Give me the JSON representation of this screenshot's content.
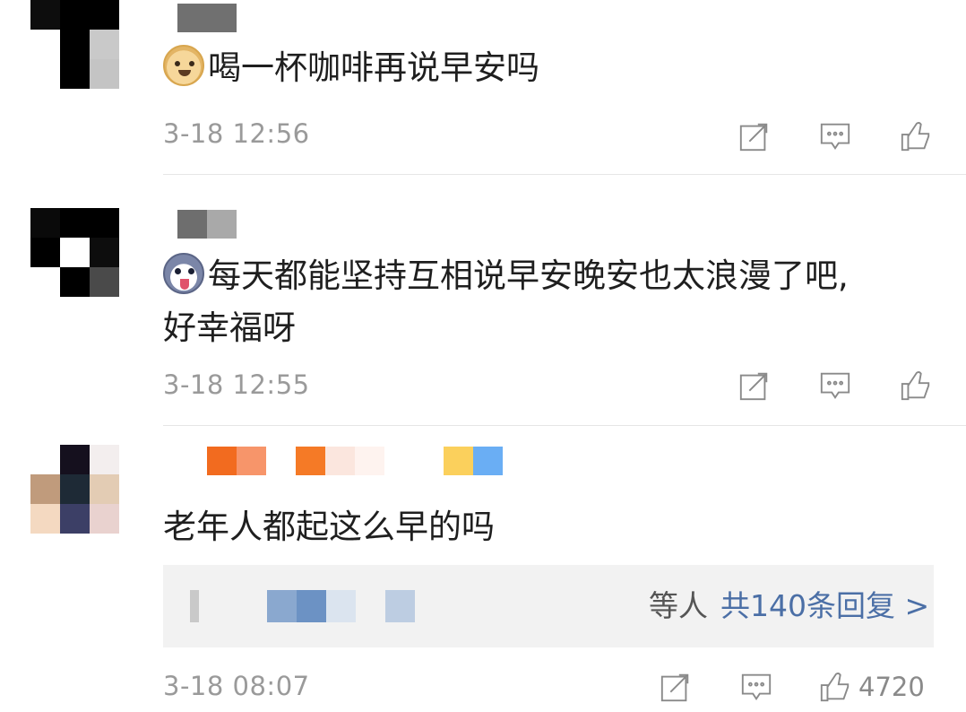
{
  "comments": [
    {
      "avatar_icon": "blurred-avatar",
      "emoji_icon": "doge-emoji",
      "text": "喝一杯咖啡再说早安吗",
      "time": "3-18 12:56"
    },
    {
      "avatar_icon": "blurred-avatar",
      "emoji_icon": "husky-emoji",
      "text_line1": "每天都能坚持互相说早安晚安也太浪漫了吧,",
      "text_line2": "好幸福呀",
      "time": "3-18 12:55"
    },
    {
      "avatar_icon": "blurred-avatar",
      "text": "老年人都起这么早的吗",
      "time": "3-18 08:07",
      "like_count": "4720",
      "replies": {
        "who_suffix": "等人",
        "link": "共140条回复 >"
      }
    }
  ],
  "icons": {
    "share": "share-icon",
    "comment": "comment-icon",
    "like": "thumbs-up-icon"
  },
  "colors": {
    "link": "#4b6fa6",
    "meta": "#9a9a9a",
    "reply_bg": "#f2f2f2"
  }
}
